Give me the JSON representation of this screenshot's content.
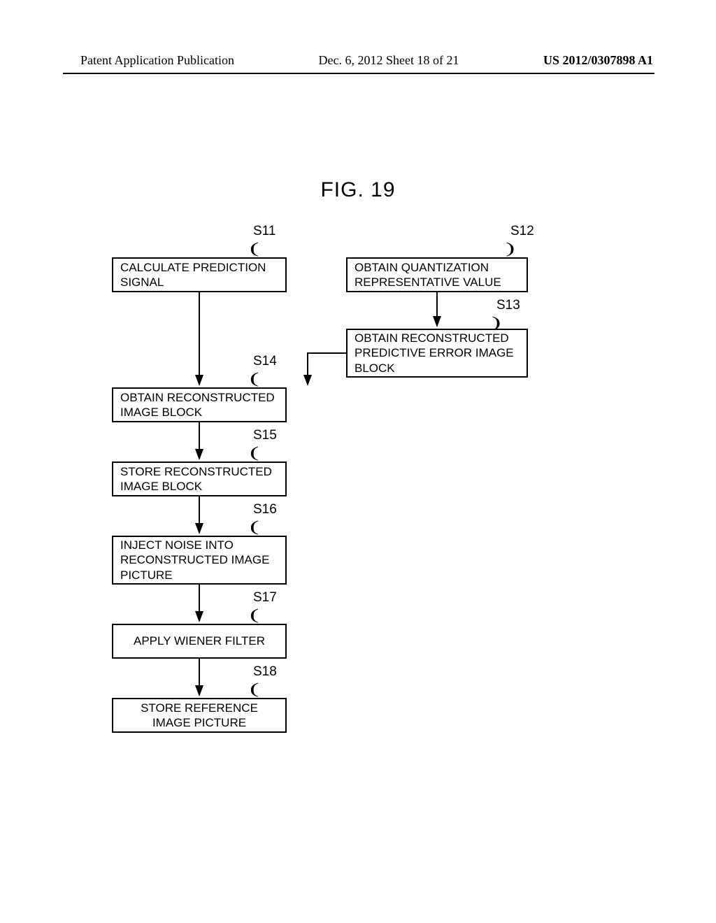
{
  "header": {
    "left": "Patent Application Publication",
    "center": "Dec. 6, 2012  Sheet 18 of 21",
    "right": "US 2012/0307898 A1"
  },
  "figure": {
    "title": "FIG. 19"
  },
  "steps": {
    "s11": {
      "ref": "S11",
      "text": "CALCULATE PREDICTION SIGNAL"
    },
    "s12": {
      "ref": "S12",
      "text": "OBTAIN QUANTIZATION REPRESENTATIVE VALUE"
    },
    "s13": {
      "ref": "S13",
      "text": "OBTAIN RECONSTRUCTED PREDICTIVE ERROR IMAGE BLOCK"
    },
    "s14": {
      "ref": "S14",
      "text": "OBTAIN RECONSTRUCTED IMAGE BLOCK"
    },
    "s15": {
      "ref": "S15",
      "text": "STORE RECONSTRUCTED IMAGE BLOCK"
    },
    "s16": {
      "ref": "S16",
      "text": "INJECT NOISE INTO RECONSTRUCTED IMAGE PICTURE"
    },
    "s17": {
      "ref": "S17",
      "text": "APPLY WIENER FILTER"
    },
    "s18": {
      "ref": "S18",
      "text": "STORE REFERENCE IMAGE PICTURE"
    }
  },
  "chart_data": {
    "type": "flowchart",
    "title": "FIG. 19",
    "nodes": [
      {
        "id": "S11",
        "label": "CALCULATE PREDICTION SIGNAL"
      },
      {
        "id": "S12",
        "label": "OBTAIN QUANTIZATION REPRESENTATIVE VALUE"
      },
      {
        "id": "S13",
        "label": "OBTAIN RECONSTRUCTED PREDICTIVE ERROR IMAGE BLOCK"
      },
      {
        "id": "S14",
        "label": "OBTAIN RECONSTRUCTED IMAGE BLOCK"
      },
      {
        "id": "S15",
        "label": "STORE RECONSTRUCTED IMAGE BLOCK"
      },
      {
        "id": "S16",
        "label": "INJECT NOISE INTO RECONSTRUCTED IMAGE PICTURE"
      },
      {
        "id": "S17",
        "label": "APPLY WIENER FILTER"
      },
      {
        "id": "S18",
        "label": "STORE REFERENCE IMAGE PICTURE"
      }
    ],
    "edges": [
      {
        "from": "S11",
        "to": "S14"
      },
      {
        "from": "S12",
        "to": "S13"
      },
      {
        "from": "S13",
        "to": "S14"
      },
      {
        "from": "S14",
        "to": "S15"
      },
      {
        "from": "S15",
        "to": "S16"
      },
      {
        "from": "S16",
        "to": "S17"
      },
      {
        "from": "S17",
        "to": "S18"
      }
    ]
  }
}
